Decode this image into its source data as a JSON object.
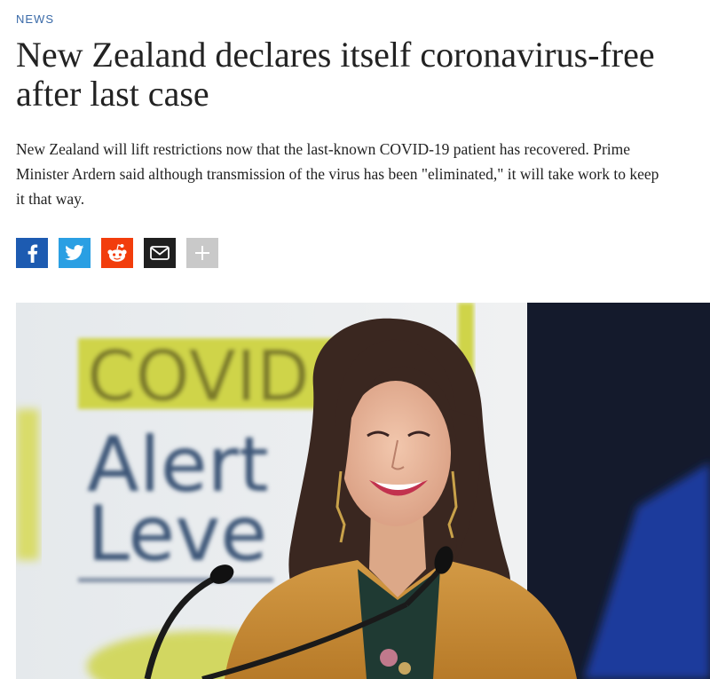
{
  "article": {
    "section": "NEWS",
    "headline": "New Zealand declares itself coronavirus-free after last case",
    "dek": "New Zealand will lift restrictions now that the last-known COVID-19 patient has recovered. Prime Minister Ardern said although transmission of the virus has been \"eliminated,\" it will take work to keep it that way."
  },
  "share": {
    "buttons": [
      {
        "icon": "facebook-icon",
        "color": "#1d5bb1"
      },
      {
        "icon": "twitter-icon",
        "color": "#2a9fe3"
      },
      {
        "icon": "reddit-icon",
        "color": "#f23d0c"
      },
      {
        "icon": "email-icon",
        "color": "#1f1f1f"
      },
      {
        "icon": "plus-icon",
        "color": "#c9c9c9"
      }
    ]
  },
  "photo": {
    "sign": {
      "line1": "COVID",
      "line2": "Alert",
      "line3": "Leve"
    },
    "colors": {
      "sign_yellow": "#cfd44a",
      "sign_text": "#3d5778",
      "jacket": "#c88a35",
      "backdrop_dark": "#141a2c",
      "backdrop_blue": "#1c3a9c"
    }
  }
}
